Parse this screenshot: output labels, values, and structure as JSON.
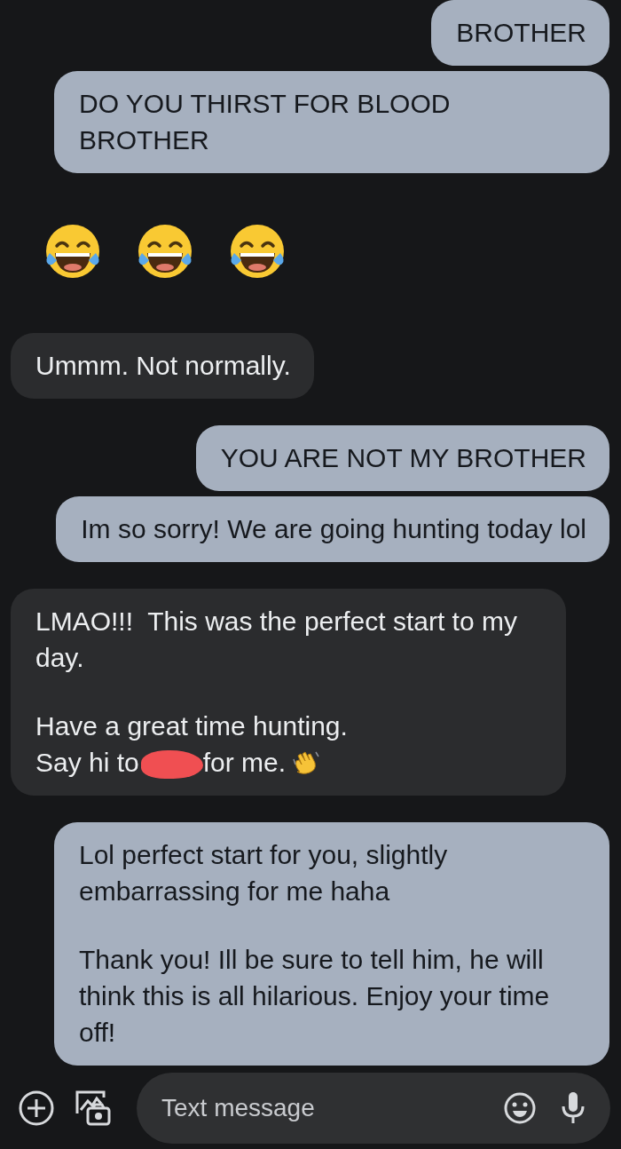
{
  "messages": [
    {
      "kind": "text",
      "sent": true,
      "paragraphs": [
        "BROTHER"
      ]
    },
    {
      "kind": "text",
      "sent": true,
      "paragraphs": [
        "DO YOU THIRST FOR BLOOD BROTHER"
      ]
    },
    {
      "kind": "emoji",
      "sent": false,
      "emojis": [
        {
          "kind": "laughing"
        },
        {
          "kind": "laughing"
        },
        {
          "kind": "laughing"
        }
      ]
    },
    {
      "kind": "text",
      "sent": false,
      "paragraphs": [
        "Ummm. Not normally."
      ]
    },
    {
      "kind": "text",
      "sent": true,
      "paragraphs": [
        "YOU ARE NOT MY BROTHER"
      ]
    },
    {
      "kind": "text",
      "sent": true,
      "paragraphs": [
        "Im so sorry! We are going hunting today lol"
      ]
    },
    {
      "kind": "text",
      "sent": false,
      "paragraphs": [
        "LMAO!!!  This was the perfect start to my day.",
        "Have a great time hunting."
      ],
      "redacted_line": {
        "before": "Say hi to",
        "after": "for me.",
        "trailing_emoji": {
          "kind": "waving"
        }
      }
    },
    {
      "kind": "text",
      "sent": true,
      "paragraphs": [
        "Lol perfect start for you, slightly embarrassing for me haha",
        "Thank you! Ill be sure to tell him, he will think this is all hilarious. Enjoy your time off!"
      ]
    }
  ],
  "composer": {
    "placeholder": "Text message"
  }
}
